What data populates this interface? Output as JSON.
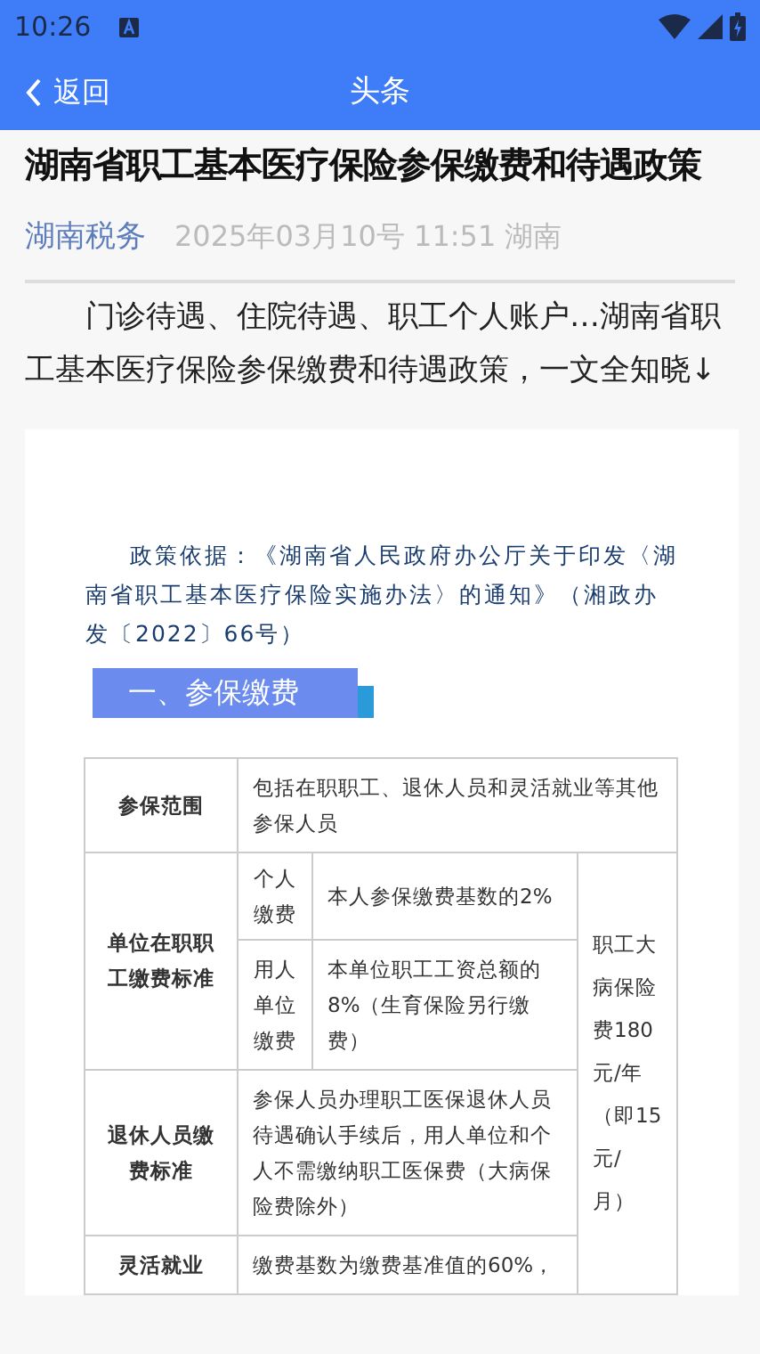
{
  "status_bar": {
    "time": "10:26"
  },
  "app_bar": {
    "back_label": "返回",
    "title": "头条"
  },
  "article": {
    "title": "湖南省职工基本医疗保险参保缴费和待遇政策",
    "source": "湖南税务",
    "meta": "2025年03月10号 11:51 湖南",
    "intro": "门诊待遇、住院待遇、职工个人账户…湖南省职工基本医疗保险参保缴费和待遇政策，一文全知晓↓"
  },
  "figure": {
    "policy_basis": "政策依据：《湖南省人民政府办公厅关于印发〈湖南省职工基本医疗保险实施办法〉的通知》（湘政办发〔2022〕66号）",
    "section_heading": "一、参保缴费",
    "table": {
      "side_note": "职工大病保险费180元/年（即15元/月）",
      "rows": [
        {
          "label": "参保范围",
          "value": "包括在职职工、退休人员和灵活就业等其他参保人员"
        },
        {
          "label": "单位在职职工缴费标准",
          "children": [
            {
              "label": "个人缴费",
              "value": "本人参保缴费基数的2%"
            },
            {
              "label": "用人单位缴费",
              "value": "本单位职工工资总额的8%（生育保险另行缴费）"
            }
          ]
        },
        {
          "label": "退休人员缴费标准",
          "value": "参保人员办理职工医保退休人员待遇确认手续后，用人单位和个人不需缴纳职工医保费（大病保险费除外）"
        },
        {
          "label": "灵活就业",
          "value": "缴费基数为缴费基准值的60%，"
        }
      ]
    }
  }
}
